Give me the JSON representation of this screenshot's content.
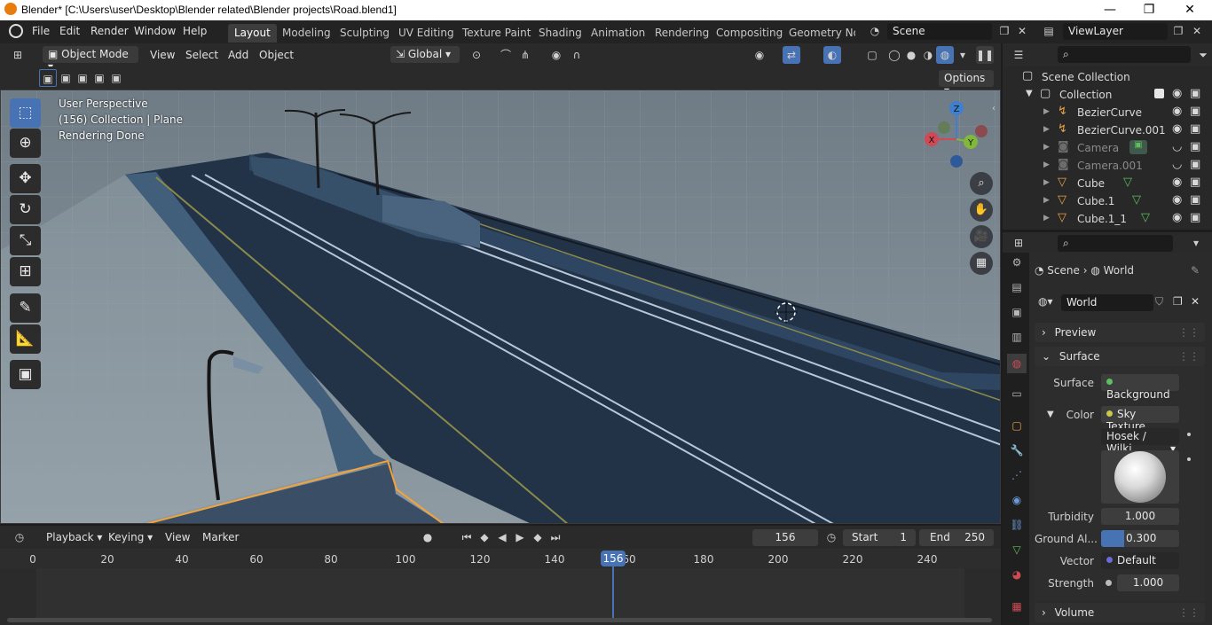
{
  "window": {
    "title": "Blender* [C:\\Users\\user\\Desktop\\Blender related\\Blender projects\\Road.blend1]",
    "minimize": "—",
    "maximize": "❐",
    "close": "✕"
  },
  "menubar": {
    "items": [
      "File",
      "Edit",
      "Render",
      "Window",
      "Help"
    ]
  },
  "workspaces": {
    "tabs": [
      "Layout",
      "Modeling",
      "Sculpting",
      "UV Editing",
      "Texture Paint",
      "Shading",
      "Animation",
      "Rendering",
      "Compositing",
      "Geometry Noc"
    ],
    "active": "Layout"
  },
  "scene_selector": {
    "value": "Scene"
  },
  "viewlayer_selector": {
    "value": "ViewLayer"
  },
  "viewport_header": {
    "mode": "Object Mode",
    "menus": [
      "View",
      "Select",
      "Add",
      "Object"
    ],
    "orientation": "Global",
    "options_label": "Options"
  },
  "viewport_overlay": {
    "line1": "User Perspective",
    "line2": "(156) Collection | Plane",
    "line3": "Rendering Done"
  },
  "gizmo": {
    "x": "X",
    "y": "Y",
    "z": "Z"
  },
  "timeline": {
    "menus": [
      "Playback",
      "Keying",
      "View",
      "Marker"
    ],
    "current_frame": "156",
    "start_label": "Start",
    "start_value": "1",
    "end_label": "End",
    "end_value": "250",
    "ticks": [
      "0",
      "20",
      "40",
      "60",
      "80",
      "100",
      "120",
      "140",
      "156",
      "180",
      "200",
      "220",
      "240"
    ],
    "playhead_frame": 156,
    "tick_hidden": "60"
  },
  "outliner": {
    "root": "Scene Collection",
    "collection": "Collection",
    "items": [
      {
        "name": "BezierCurve",
        "icon": "curve-icon",
        "dim": false
      },
      {
        "name": "BezierCurve.001",
        "icon": "curve-icon",
        "dim": false
      },
      {
        "name": "Camera",
        "icon": "camera-icon",
        "dim": true
      },
      {
        "name": "Camera.001",
        "icon": "camera-icon",
        "dim": true
      },
      {
        "name": "Cube",
        "icon": "mesh-icon",
        "dim": false
      },
      {
        "name": "Cube.1",
        "icon": "mesh-icon",
        "dim": false
      },
      {
        "name": "Cube.1_1",
        "icon": "mesh-icon",
        "dim": false
      }
    ]
  },
  "properties": {
    "breadcrumb_scene": "Scene",
    "breadcrumb_world": "World",
    "world_name": "World",
    "panels": {
      "preview": "Preview",
      "surface": "Surface",
      "volume": "Volume"
    },
    "surface_label": "Surface",
    "surface_value": "Background",
    "color_label": "Color",
    "color_value": "Sky Texture",
    "sky_type": "Hosek / Wilki",
    "turbidity_label": "Turbidity",
    "turbidity_value": "1.000",
    "ground_label": "Ground Al...",
    "ground_value": "0.300",
    "vector_label": "Vector",
    "vector_value": "Default",
    "strength_label": "Strength",
    "strength_value": "1.000"
  },
  "colors": {
    "accent": "#4772b3",
    "selection_outline": "#f4a23a",
    "surface_dot": "#5fbf5f",
    "color_dot": "#c8c84a",
    "vector_dot": "#6b6bd6"
  }
}
